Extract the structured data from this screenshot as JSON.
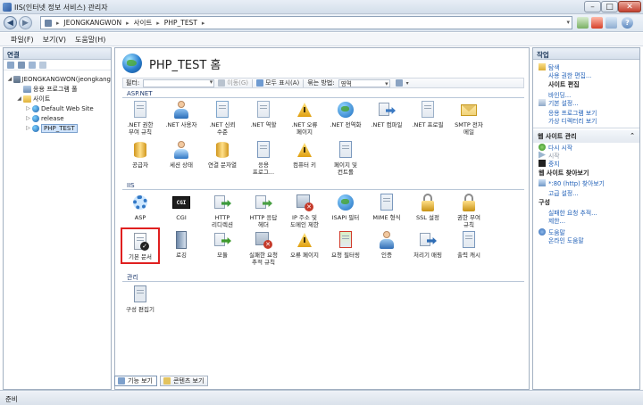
{
  "window": {
    "title": "IIS(인터넷 정보 서비스) 관리자"
  },
  "address": {
    "crumbs": [
      "JEONGKANGWON",
      "사이트",
      "PHP_TEST"
    ]
  },
  "menu": {
    "items": [
      "파일(F)",
      "보기(V)",
      "도움말(H)"
    ]
  },
  "connections": {
    "title": "연결",
    "tree": [
      {
        "label": "JEONGKANGWON(jeongkang",
        "level": 0,
        "icon": "server-icon",
        "twisty": "◢"
      },
      {
        "label": "응용 프로그램 풀",
        "level": 1,
        "icon": "app-pool-icon",
        "twisty": ""
      },
      {
        "label": "사이트",
        "level": 1,
        "icon": "sites-folder-icon",
        "twisty": "◢"
      },
      {
        "label": "Default Web Site",
        "level": 2,
        "icon": "website-globe-icon",
        "twisty": "▷"
      },
      {
        "label": "release",
        "level": 2,
        "icon": "website-globe-icon",
        "twisty": "▷"
      },
      {
        "label": "PHP_TEST",
        "level": 2,
        "icon": "website-globe-icon",
        "twisty": "▷",
        "selected": true
      }
    ]
  },
  "main": {
    "title": "PHP_TEST 홈",
    "filter": {
      "label": "필터:",
      "go": "이동(G)",
      "show_all": "모두 표시(A)",
      "group_by_label": "묶는 방법:",
      "group_by_value": "영역"
    },
    "sections": {
      "aspnet": "ASP.NET",
      "iis": "IIS",
      "management": "관리"
    },
    "features": {
      "aspnet_row1": [
        {
          "label": ".NET 권한\n부여 규칙",
          "icon": "net-authorization-icon"
        },
        {
          "label": ".NET 사용자",
          "icon": "net-users-icon"
        },
        {
          "label": ".NET 신뢰\n수준",
          "icon": "net-trust-icon"
        },
        {
          "label": ".NET 역할",
          "icon": "net-roles-icon"
        },
        {
          "label": ".NET 오류\n페이지",
          "icon": "net-error-pages-icon"
        },
        {
          "label": ".NET 전역화",
          "icon": "net-globalization-icon"
        },
        {
          "label": ".NET 컴파일",
          "icon": "net-compilation-icon"
        },
        {
          "label": ".NET 프로필",
          "icon": "net-profile-icon"
        },
        {
          "label": "SMTP 전자\n메일",
          "icon": "smtp-email-icon"
        }
      ],
      "aspnet_row2": [
        {
          "label": "공급자",
          "icon": "providers-icon"
        },
        {
          "label": "세션 상태",
          "icon": "session-state-icon"
        },
        {
          "label": "연결 문자열",
          "icon": "connection-strings-icon"
        },
        {
          "label": "응용\n프로그...",
          "icon": "app-settings-icon"
        },
        {
          "label": "컴퓨터 키",
          "icon": "machine-key-icon"
        },
        {
          "label": "페이지 및\n컨트롤",
          "icon": "pages-controls-icon"
        }
      ],
      "iis_row1": [
        {
          "label": "ASP",
          "icon": "asp-icon"
        },
        {
          "label": "CGI",
          "icon": "cgi-icon"
        },
        {
          "label": "HTTP\n리디렉션",
          "icon": "http-redirect-icon"
        },
        {
          "label": "HTTP 응답\n헤더",
          "icon": "http-response-headers-icon"
        },
        {
          "label": "IP 주소 및\n도메인 제한",
          "icon": "ip-domain-restrictions-icon"
        },
        {
          "label": "ISAPI 필터",
          "icon": "isapi-filters-icon"
        },
        {
          "label": "MIME 형식",
          "icon": "mime-types-icon"
        },
        {
          "label": "SSL 설정",
          "icon": "ssl-settings-icon"
        },
        {
          "label": "권한 부여\n규칙",
          "icon": "authorization-rules-icon"
        }
      ],
      "iis_row2": [
        {
          "label": "기본 문서",
          "icon": "default-document-icon",
          "highlight": true
        },
        {
          "label": "로깅",
          "icon": "logging-icon"
        },
        {
          "label": "모듈",
          "icon": "modules-icon"
        },
        {
          "label": "실패한 요청\n추적 규칙",
          "icon": "failed-request-tracing-icon"
        },
        {
          "label": "오류 페이지",
          "icon": "error-pages-icon"
        },
        {
          "label": "요청 필터링",
          "icon": "request-filtering-icon"
        },
        {
          "label": "인증",
          "icon": "authentication-icon"
        },
        {
          "label": "처리기 매핑",
          "icon": "handler-mappings-icon"
        },
        {
          "label": "출력 캐시",
          "icon": "output-cache-icon"
        }
      ],
      "mgmt_row1": [
        {
          "label": "구성 편집기",
          "icon": "config-editor-icon"
        }
      ]
    },
    "bottom_tabs": {
      "features_view": "기능 보기",
      "content_view": "콘텐츠 보기"
    }
  },
  "actions": {
    "title": "작업",
    "explore": "탐색",
    "edit_permissions": "사용 권한 편집...",
    "edit_site_head": "사이트 편집",
    "bindings": "바인딩...",
    "basic_settings": "기본 설정...",
    "view_applications": "응용 프로그램 보기",
    "view_virtual_dirs": "가상 디렉터리 보기",
    "manage_site_head": "웹 사이트 관리",
    "restart": "다시 시작",
    "start": "시작",
    "stop": "중지",
    "browse_site_head": "웹 사이트 찾아보기",
    "browse_http": "*:80 (http) 찾아보기",
    "advanced_settings": "고급 설정...",
    "configure_head": "구성",
    "failed_request_tracing": "실패한 요청 추적...",
    "limits": "제한...",
    "help": "도움말",
    "online_help": "온라인 도움말"
  },
  "status": {
    "text": "준비"
  }
}
